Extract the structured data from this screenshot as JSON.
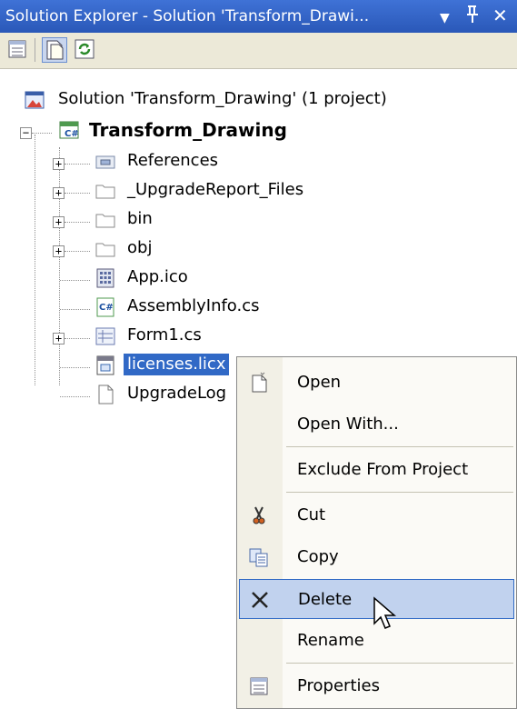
{
  "window": {
    "title": "Solution Explorer - Solution 'Transform_Drawi...",
    "buttons": {
      "dropdown": "▼",
      "pin": "ᵖ",
      "close": "✕"
    }
  },
  "toolbar": {
    "tools": [
      "properties-icon",
      "show-all-files-icon",
      "refresh-icon"
    ]
  },
  "tree": {
    "solution": "Solution 'Transform_Drawing' (1 project)",
    "project": "Transform_Drawing",
    "items": [
      {
        "label": "References",
        "icon": "references-icon",
        "expandable": true
      },
      {
        "label": "_UpgradeReport_Files",
        "icon": "folder-icon",
        "expandable": true
      },
      {
        "label": "bin",
        "icon": "folder-icon",
        "expandable": true
      },
      {
        "label": "obj",
        "icon": "folder-icon",
        "expandable": true
      },
      {
        "label": "App.ico",
        "icon": "ico-file-icon",
        "expandable": false
      },
      {
        "label": "AssemblyInfo.cs",
        "icon": "csharp-file-icon",
        "expandable": false
      },
      {
        "label": "Form1.cs",
        "icon": "form-icon",
        "expandable": true
      },
      {
        "label": "licenses.licx",
        "icon": "licx-file-icon",
        "expandable": false,
        "selected": true
      },
      {
        "label": "UpgradeLog",
        "icon": "document-icon",
        "expandable": false
      }
    ]
  },
  "context_menu": {
    "items": [
      {
        "label": "Open",
        "icon": "open-icon"
      },
      {
        "label": "Open With...",
        "icon": ""
      },
      {
        "label": "Exclude From Project",
        "icon": ""
      },
      {
        "label": "Cut",
        "icon": "scissors-icon"
      },
      {
        "label": "Copy",
        "icon": "copy-icon"
      },
      {
        "label": "Delete",
        "icon": "delete-x-icon",
        "highlighted": true
      },
      {
        "label": "Rename",
        "icon": ""
      },
      {
        "label": "Properties",
        "icon": "properties-icon"
      }
    ]
  },
  "colors": {
    "title_bar": "#2e5fc2",
    "selection": "#3169c6",
    "menu_highlight": "#c1d2ee",
    "menu_highlight_border": "#316ac5"
  }
}
